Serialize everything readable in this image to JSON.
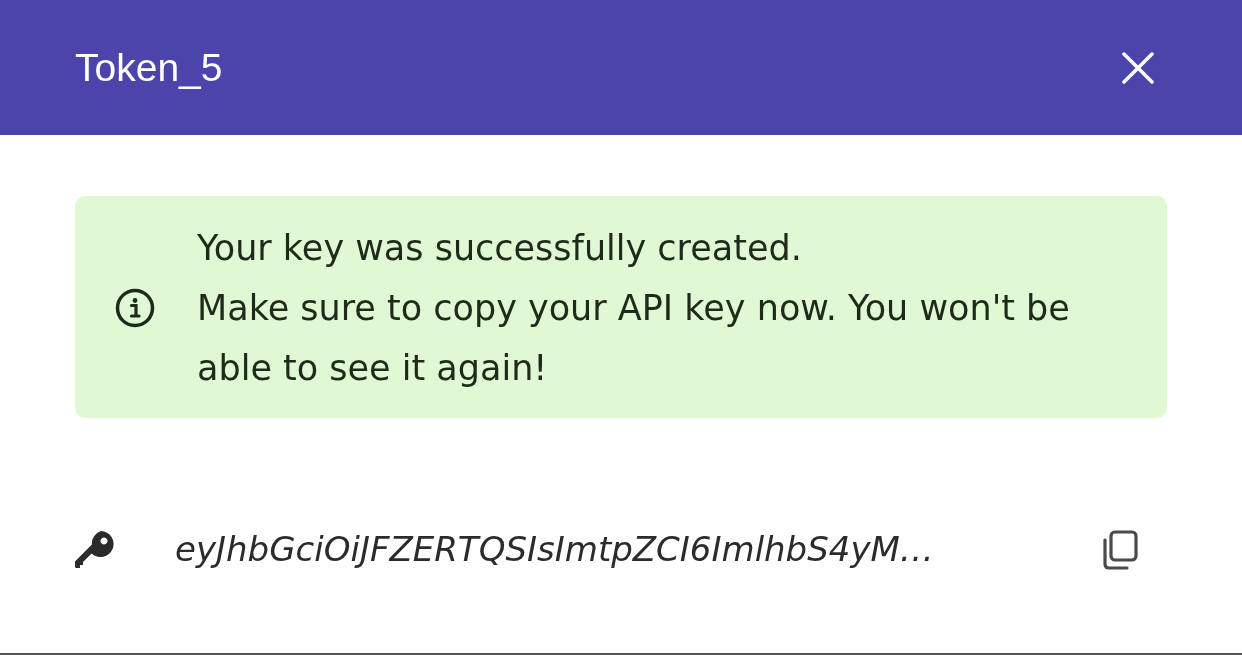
{
  "dialog": {
    "title": "Token_5"
  },
  "alert": {
    "messages": [
      "Your key was successfully created.",
      "Make sure to copy your API key now. You won't be able to see it again!"
    ]
  },
  "token": {
    "value": "eyJhbGciOiJFZERTQSIsImtpZCI6ImlhbS4yM…"
  }
}
